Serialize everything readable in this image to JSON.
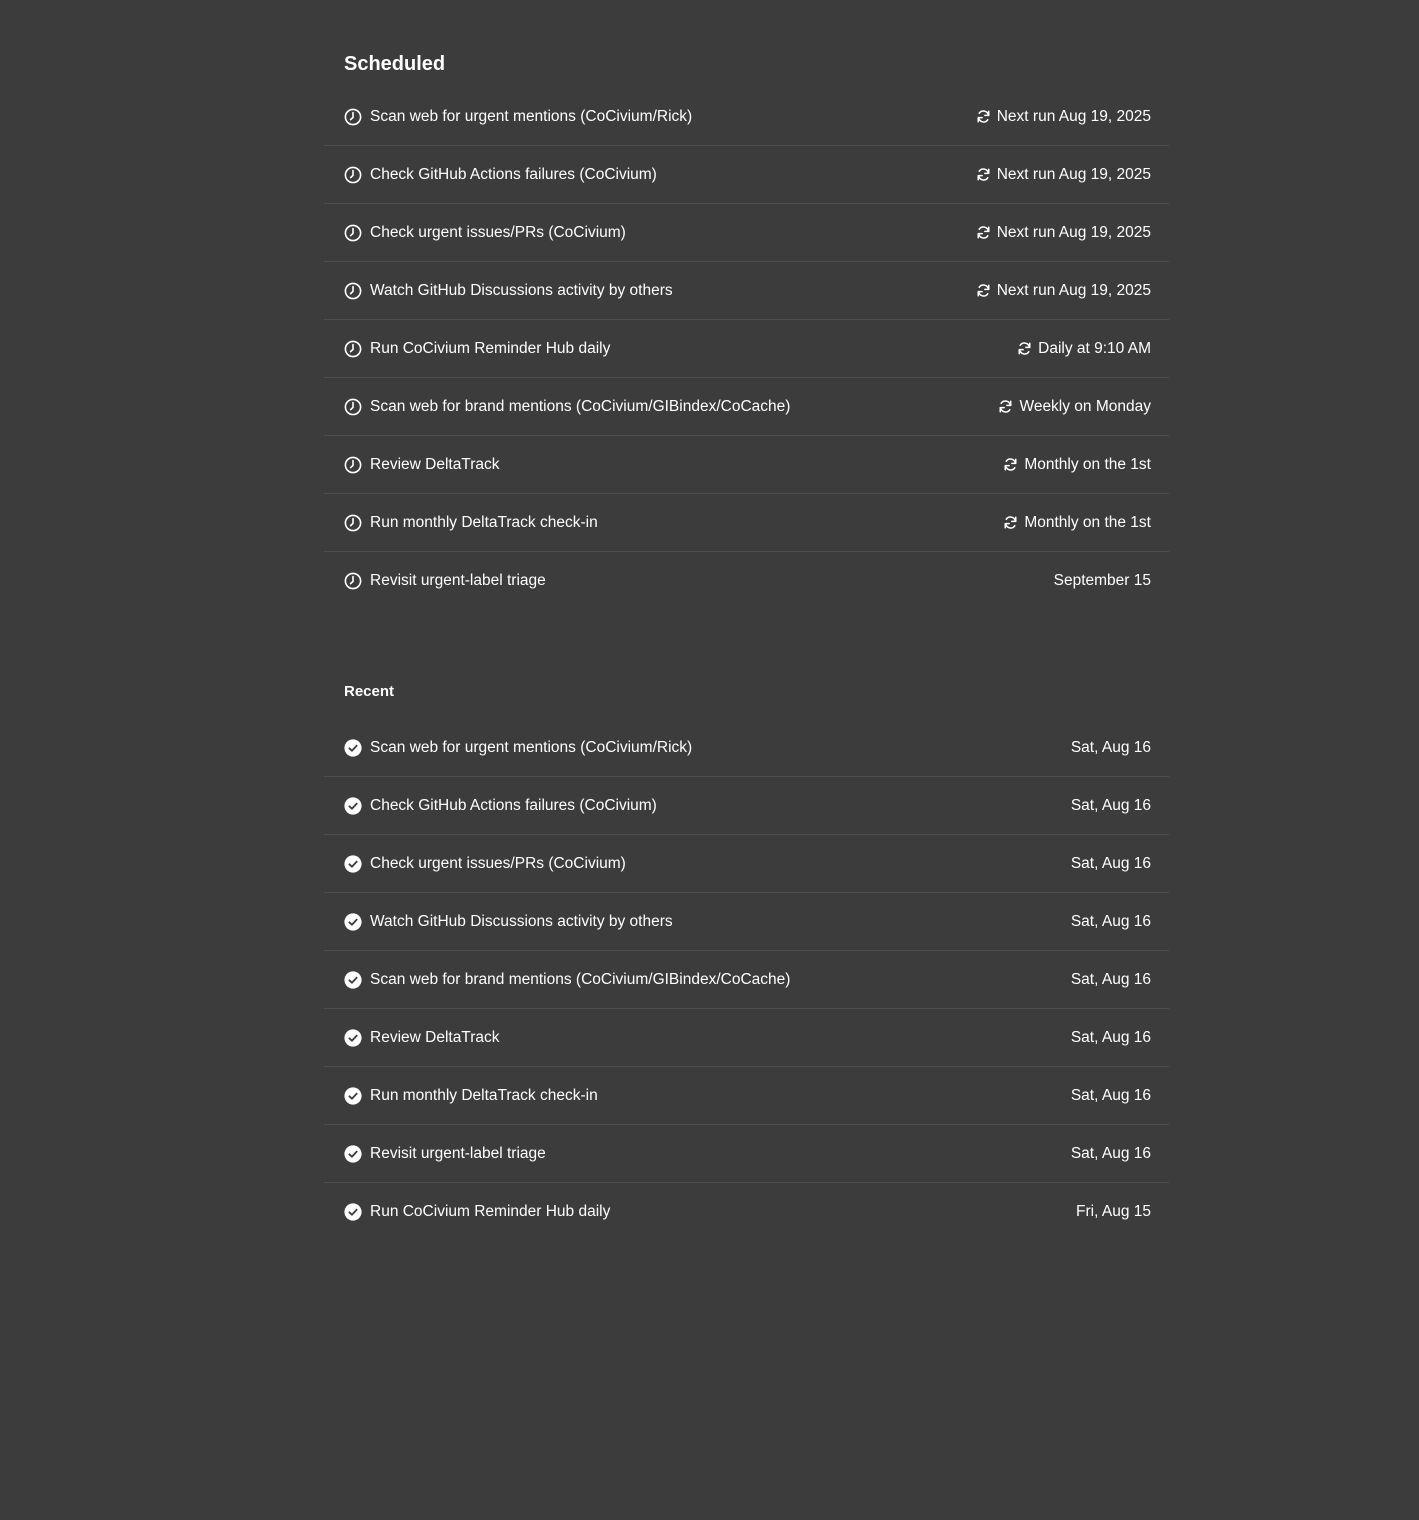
{
  "scheduled": {
    "title": "Scheduled",
    "items": [
      {
        "label": "Scan web for urgent mentions (CoCivium/Rick)",
        "when": "Next run Aug 19, 2025",
        "recurring": true,
        "icon": "clock-icon"
      },
      {
        "label": "Check GitHub Actions failures (CoCivium)",
        "when": "Next run Aug 19, 2025",
        "recurring": true,
        "icon": "clock-icon"
      },
      {
        "label": "Check urgent issues/PRs (CoCivium)",
        "when": "Next run Aug 19, 2025",
        "recurring": true,
        "icon": "clock-icon"
      },
      {
        "label": "Watch GitHub Discussions activity by others",
        "when": "Next run Aug 19, 2025",
        "recurring": true,
        "icon": "clock-icon"
      },
      {
        "label": "Run CoCivium Reminder Hub daily",
        "when": "Daily at 9:10 AM",
        "recurring": true,
        "icon": "clock-icon"
      },
      {
        "label": "Scan web for brand mentions (CoCivium/GIBindex/CoCache)",
        "when": "Weekly on Monday",
        "recurring": true,
        "icon": "clock-icon"
      },
      {
        "label": "Review DeltaTrack",
        "when": "Monthly on the 1st",
        "recurring": true,
        "icon": "clock-icon"
      },
      {
        "label": "Run monthly DeltaTrack check-in",
        "when": "Monthly on the 1st",
        "recurring": true,
        "icon": "clock-icon"
      },
      {
        "label": "Revisit urgent-label triage",
        "when": "September 15",
        "recurring": false,
        "icon": "clock-icon"
      }
    ]
  },
  "recent": {
    "title": "Recent",
    "items": [
      {
        "label": "Scan web for urgent mentions (CoCivium/Rick)",
        "when": "Sat, Aug 16",
        "icon": "check-circle-icon"
      },
      {
        "label": "Check GitHub Actions failures (CoCivium)",
        "when": "Sat, Aug 16",
        "icon": "check-circle-icon"
      },
      {
        "label": "Check urgent issues/PRs (CoCivium)",
        "when": "Sat, Aug 16",
        "icon": "check-circle-icon"
      },
      {
        "label": "Watch GitHub Discussions activity by others",
        "when": "Sat, Aug 16",
        "icon": "check-circle-icon"
      },
      {
        "label": "Scan web for brand mentions (CoCivium/GIBindex/CoCache)",
        "when": "Sat, Aug 16",
        "icon": "check-circle-icon"
      },
      {
        "label": "Review DeltaTrack",
        "when": "Sat, Aug 16",
        "icon": "check-circle-icon"
      },
      {
        "label": "Run monthly DeltaTrack check-in",
        "when": "Sat, Aug 16",
        "icon": "check-circle-icon"
      },
      {
        "label": "Revisit urgent-label triage",
        "when": "Sat, Aug 16",
        "icon": "check-circle-icon"
      },
      {
        "label": "Run CoCivium Reminder Hub daily",
        "when": "Fri, Aug 15",
        "icon": "check-circle-icon"
      }
    ]
  },
  "colors": {
    "background": "#3c3c3c",
    "divider": "#4f4f4f",
    "text": "#ffffff"
  }
}
